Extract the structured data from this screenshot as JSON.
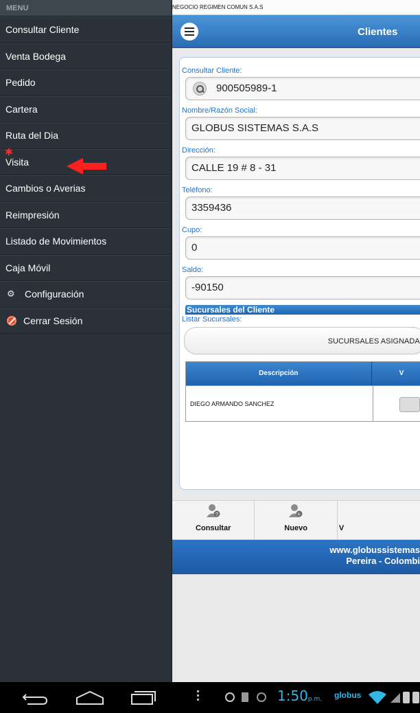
{
  "sidebar": {
    "header": "MENU",
    "items": [
      {
        "label": "Consultar Cliente"
      },
      {
        "label": "Venta Bodega"
      },
      {
        "label": "Pedido"
      },
      {
        "label": "Cartera"
      },
      {
        "label": "Ruta del Dia"
      },
      {
        "label": "Visita"
      },
      {
        "label": "Cambios o Averias"
      },
      {
        "label": "Reimpresión"
      },
      {
        "label": "Listado de Movimientos"
      },
      {
        "label": "Caja Móvil"
      },
      {
        "label": "Configuración",
        "icon": "gear-icon"
      },
      {
        "label": "Cerrar Sesión",
        "icon": "stop-icon"
      }
    ]
  },
  "status_strip": "NEGOCIO REGIMEN COMUN S.A.S",
  "header": {
    "title": "Clientes"
  },
  "form": {
    "consultar_label": "Consultar Cliente:",
    "consultar_value": "900505989-1",
    "nombre_label": "Nombre/Razón Social:",
    "nombre_value": "GLOBUS SISTEMAS S.A.S",
    "direccion_label": "Dirección:",
    "direccion_value": "CALLE 19 # 8 - 31",
    "telefono_label": "Teléfono:",
    "telefono_value": "3359436",
    "cupo_label": "Cupo:",
    "cupo_value": "0",
    "saldo_label": "Saldo:",
    "saldo_value": "-90150"
  },
  "sucursales": {
    "section_title": "Sucursales del Cliente",
    "list_label": "Listar Sucursales:",
    "button_label": "SUCURSALES ASIGNADAS",
    "columns": [
      "Descripción",
      "V"
    ],
    "rows": [
      {
        "descripcion": "DIEGO ARMANDO SANCHEZ"
      }
    ]
  },
  "toolbar": {
    "consultar": "Consultar",
    "nuevo": "Nuevo",
    "third": "V"
  },
  "footer": {
    "line1": "www.globussistemas",
    "line2": "Pereira - Colombi"
  },
  "navbar": {
    "time": "1:50",
    "ampm": "p.m.",
    "carrier": "globus"
  },
  "colors": {
    "accent": "#2a6cb4",
    "sidebar_bg": "#2a3138",
    "label_blue": "#1f73c7",
    "clock_blue": "#33b5e5"
  }
}
